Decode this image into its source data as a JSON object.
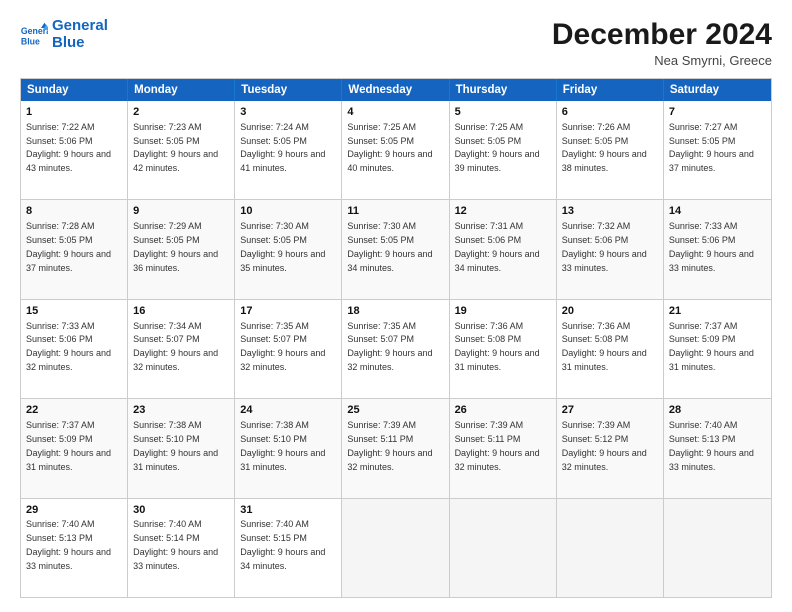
{
  "logo": {
    "line1": "General",
    "line2": "Blue"
  },
  "title": "December 2024",
  "location": "Nea Smyrni, Greece",
  "days_of_week": [
    "Sunday",
    "Monday",
    "Tuesday",
    "Wednesday",
    "Thursday",
    "Friday",
    "Saturday"
  ],
  "weeks": [
    [
      {
        "num": "1",
        "sunrise": "7:22 AM",
        "sunset": "5:06 PM",
        "daylight": "9 hours and 43 minutes."
      },
      {
        "num": "2",
        "sunrise": "7:23 AM",
        "sunset": "5:05 PM",
        "daylight": "9 hours and 42 minutes."
      },
      {
        "num": "3",
        "sunrise": "7:24 AM",
        "sunset": "5:05 PM",
        "daylight": "9 hours and 41 minutes."
      },
      {
        "num": "4",
        "sunrise": "7:25 AM",
        "sunset": "5:05 PM",
        "daylight": "9 hours and 40 minutes."
      },
      {
        "num": "5",
        "sunrise": "7:25 AM",
        "sunset": "5:05 PM",
        "daylight": "9 hours and 39 minutes."
      },
      {
        "num": "6",
        "sunrise": "7:26 AM",
        "sunset": "5:05 PM",
        "daylight": "9 hours and 38 minutes."
      },
      {
        "num": "7",
        "sunrise": "7:27 AM",
        "sunset": "5:05 PM",
        "daylight": "9 hours and 37 minutes."
      }
    ],
    [
      {
        "num": "8",
        "sunrise": "7:28 AM",
        "sunset": "5:05 PM",
        "daylight": "9 hours and 37 minutes."
      },
      {
        "num": "9",
        "sunrise": "7:29 AM",
        "sunset": "5:05 PM",
        "daylight": "9 hours and 36 minutes."
      },
      {
        "num": "10",
        "sunrise": "7:30 AM",
        "sunset": "5:05 PM",
        "daylight": "9 hours and 35 minutes."
      },
      {
        "num": "11",
        "sunrise": "7:30 AM",
        "sunset": "5:05 PM",
        "daylight": "9 hours and 34 minutes."
      },
      {
        "num": "12",
        "sunrise": "7:31 AM",
        "sunset": "5:06 PM",
        "daylight": "9 hours and 34 minutes."
      },
      {
        "num": "13",
        "sunrise": "7:32 AM",
        "sunset": "5:06 PM",
        "daylight": "9 hours and 33 minutes."
      },
      {
        "num": "14",
        "sunrise": "7:33 AM",
        "sunset": "5:06 PM",
        "daylight": "9 hours and 33 minutes."
      }
    ],
    [
      {
        "num": "15",
        "sunrise": "7:33 AM",
        "sunset": "5:06 PM",
        "daylight": "9 hours and 32 minutes."
      },
      {
        "num": "16",
        "sunrise": "7:34 AM",
        "sunset": "5:07 PM",
        "daylight": "9 hours and 32 minutes."
      },
      {
        "num": "17",
        "sunrise": "7:35 AM",
        "sunset": "5:07 PM",
        "daylight": "9 hours and 32 minutes."
      },
      {
        "num": "18",
        "sunrise": "7:35 AM",
        "sunset": "5:07 PM",
        "daylight": "9 hours and 32 minutes."
      },
      {
        "num": "19",
        "sunrise": "7:36 AM",
        "sunset": "5:08 PM",
        "daylight": "9 hours and 31 minutes."
      },
      {
        "num": "20",
        "sunrise": "7:36 AM",
        "sunset": "5:08 PM",
        "daylight": "9 hours and 31 minutes."
      },
      {
        "num": "21",
        "sunrise": "7:37 AM",
        "sunset": "5:09 PM",
        "daylight": "9 hours and 31 minutes."
      }
    ],
    [
      {
        "num": "22",
        "sunrise": "7:37 AM",
        "sunset": "5:09 PM",
        "daylight": "9 hours and 31 minutes."
      },
      {
        "num": "23",
        "sunrise": "7:38 AM",
        "sunset": "5:10 PM",
        "daylight": "9 hours and 31 minutes."
      },
      {
        "num": "24",
        "sunrise": "7:38 AM",
        "sunset": "5:10 PM",
        "daylight": "9 hours and 31 minutes."
      },
      {
        "num": "25",
        "sunrise": "7:39 AM",
        "sunset": "5:11 PM",
        "daylight": "9 hours and 32 minutes."
      },
      {
        "num": "26",
        "sunrise": "7:39 AM",
        "sunset": "5:11 PM",
        "daylight": "9 hours and 32 minutes."
      },
      {
        "num": "27",
        "sunrise": "7:39 AM",
        "sunset": "5:12 PM",
        "daylight": "9 hours and 32 minutes."
      },
      {
        "num": "28",
        "sunrise": "7:40 AM",
        "sunset": "5:13 PM",
        "daylight": "9 hours and 33 minutes."
      }
    ],
    [
      {
        "num": "29",
        "sunrise": "7:40 AM",
        "sunset": "5:13 PM",
        "daylight": "9 hours and 33 minutes."
      },
      {
        "num": "30",
        "sunrise": "7:40 AM",
        "sunset": "5:14 PM",
        "daylight": "9 hours and 33 minutes."
      },
      {
        "num": "31",
        "sunrise": "7:40 AM",
        "sunset": "5:15 PM",
        "daylight": "9 hours and 34 minutes."
      },
      null,
      null,
      null,
      null
    ]
  ]
}
